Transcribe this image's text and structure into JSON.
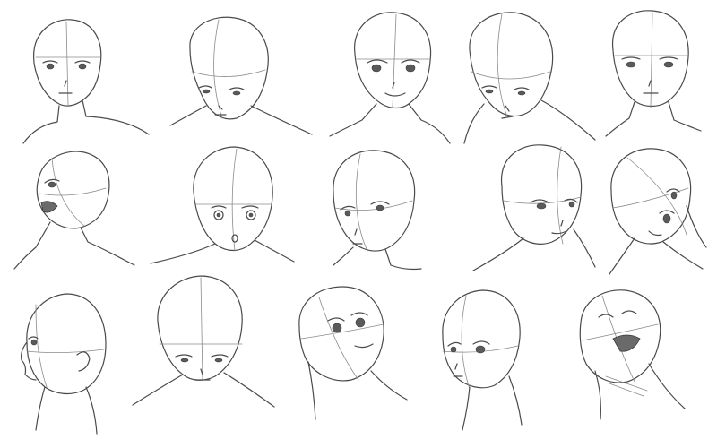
{
  "sheet": {
    "background": "#ffffff",
    "line_color": "#4a4a4a",
    "rows": [
      {
        "heads": [
          {
            "id": "h1",
            "view": "front",
            "tilt": "neutral",
            "expression": "calm"
          },
          {
            "id": "h2",
            "view": "three-quarter",
            "tilt": "down",
            "expression": "lowered-eyes"
          },
          {
            "id": "h3",
            "view": "front",
            "tilt": "neutral",
            "expression": "smile"
          },
          {
            "id": "h4",
            "view": "three-quarter",
            "tilt": "down",
            "expression": "lowered-eyes"
          },
          {
            "id": "h5",
            "view": "front",
            "tilt": "neutral",
            "expression": "calm"
          }
        ]
      },
      {
        "heads": [
          {
            "id": "h6",
            "view": "three-quarter",
            "tilt": "up",
            "expression": "open-mouth"
          },
          {
            "id": "h7",
            "view": "front",
            "tilt": "down",
            "expression": "surprised"
          },
          {
            "id": "h8",
            "view": "three-quarter",
            "tilt": "neutral",
            "expression": "calm"
          },
          {
            "id": "h9",
            "view": "three-quarter",
            "tilt": "neutral",
            "expression": "smirk"
          },
          {
            "id": "h10",
            "view": "three-quarter",
            "tilt": "up-tilted",
            "expression": "calm"
          }
        ]
      },
      {
        "heads": [
          {
            "id": "h11",
            "view": "profile",
            "tilt": "neutral",
            "expression": "calm"
          },
          {
            "id": "h12",
            "view": "front",
            "tilt": "down",
            "expression": "lowered-eyes"
          },
          {
            "id": "h13",
            "view": "three-quarter",
            "tilt": "up",
            "expression": "smile"
          },
          {
            "id": "h14",
            "view": "three-quarter",
            "tilt": "neutral",
            "expression": "calm"
          },
          {
            "id": "h15",
            "view": "three-quarter",
            "tilt": "up",
            "expression": "laughing"
          }
        ]
      }
    ]
  }
}
